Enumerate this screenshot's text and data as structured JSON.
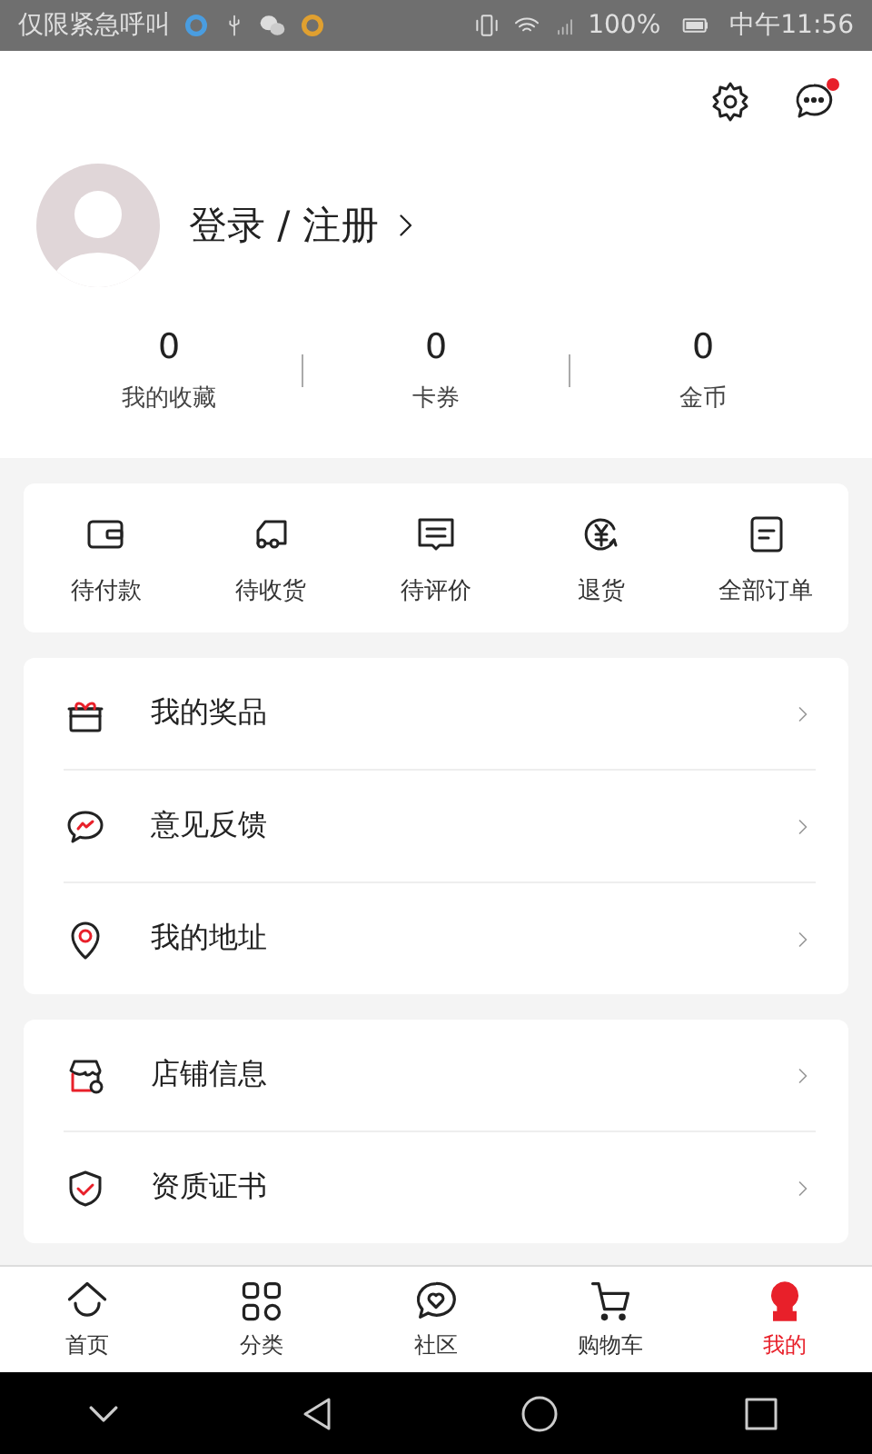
{
  "status_bar": {
    "carrier": "仅限紧急呼叫",
    "battery": "100%",
    "time": "中午11:56"
  },
  "header": {
    "messages_unread": true
  },
  "profile": {
    "login": "登录 / 注册"
  },
  "stats": [
    {
      "value": "0",
      "label": "我的收藏"
    },
    {
      "value": "0",
      "label": "卡券"
    },
    {
      "value": "0",
      "label": "金币"
    }
  ],
  "orders": [
    {
      "label": "待付款"
    },
    {
      "label": "待收货"
    },
    {
      "label": "待评价"
    },
    {
      "label": "退货"
    },
    {
      "label": "全部订单"
    }
  ],
  "menu_groups": [
    [
      {
        "label": "我的奖品"
      },
      {
        "label": "意见反馈"
      },
      {
        "label": "我的地址"
      }
    ],
    [
      {
        "label": "店铺信息"
      },
      {
        "label": "资质证书"
      }
    ]
  ],
  "tab_bar": [
    {
      "label": "首页",
      "selected": false
    },
    {
      "label": "分类",
      "selected": false
    },
    {
      "label": "社区",
      "selected": false
    },
    {
      "label": "购物车",
      "selected": false
    },
    {
      "label": "我的",
      "selected": true
    }
  ]
}
